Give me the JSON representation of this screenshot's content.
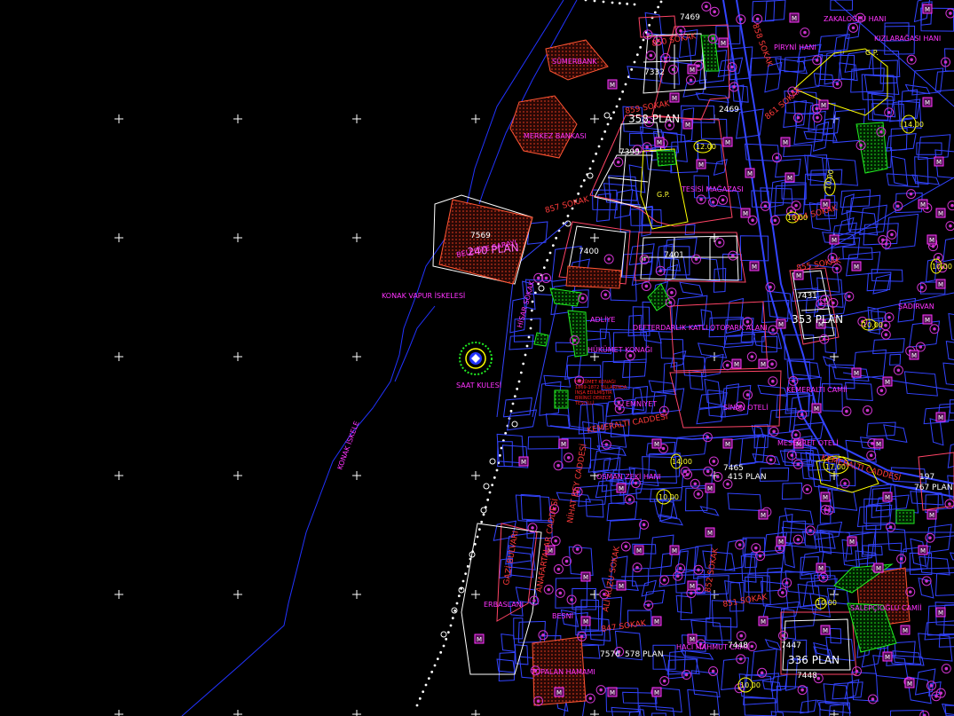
{
  "map": {
    "colors": {
      "background": "#000000",
      "coastline": "#2233ff",
      "parcel": "#3344ff",
      "parcel_pink": "#ff4466",
      "building_mag": "#ff33ff",
      "street_text": "#ff3a3a",
      "tree": "#cc33cc",
      "green": "#22ee22",
      "yellow": "#ffff00",
      "dots": "#ffffff",
      "hatch": "#aa2211",
      "grid_cross": "#ffffff"
    },
    "streets": {
      "s850": "850 SOKAK",
      "s859": "859 SOKAK",
      "s857": "857 SOKAK",
      "s861": "861 SOKAK",
      "s854": "854 SOKAK",
      "s855": "855 SOKAK",
      "s858": "858 SOKAK",
      "s851": "851 SOKAK",
      "s847": "847 SOKAK",
      "kemeralti": "KEMERALTI CADDESİ",
      "kemeralti_right": "KEMERALTI CADDESİ",
      "anafartalar": "ANAFARTALAR CADDESİ",
      "nihat": "NİHAT BEY CADDESİ",
      "cumhuriyet": "GAZİ BULVARI",
      "ali_ruza": "ALİ KUZU SOKAK",
      "konak_iskele": "KONAK İSKELE",
      "caddesi_852": "852 SOKAK",
      "cami_sok": "HİSAR SOKAK"
    },
    "places": {
      "pakaloglu": "ZAKALOĞLU HANI",
      "kiz_hani": "KIZLARAĞASI HANI",
      "pinyol_hani": "PİRYNİ HANI",
      "tesisi_magazasi": "TESİSİ MAĞAZASI",
      "merkez_bankasi": "MERKEZ BANKASI",
      "bankasi_top": "SÜMERBANK",
      "belediye": "BELEDİYE SARAYI",
      "konak_vapur": "KONAK VAPUR İSKELESİ",
      "saat_kulesi": "SAAT KULESİ",
      "adliye": "ADLİYE",
      "hukumet": "HÜKÜMET KONAĞI",
      "defterdarlik": "DEFTERDARLIK KATLI OTOPARK ALANI",
      "emniyet": "EMNİYET",
      "sinan_oteli": "SİNAN OTELİ",
      "kemeralti_cami": "KEMERALTI CAMİİ",
      "mesrret": "MESERRET OTELİ",
      "sadirvan": "ŞADIRVAN",
      "kizlar_yeni": "OSMAN ZEKİ HANI",
      "hacimahmut": "HACI MAHMUT CAMİİ",
      "tepecioglu": "SALEPÇİOĞLU CAMİİ",
      "erbasi_hani": "ERBASLANI",
      "birsel": "BESNİ",
      "camlica": "TOPALAN HAMAMI",
      "gp1": "G.P.",
      "gp2": "G.P.",
      "hukumet_note1": "HÜKÜMET KONAĞI",
      "hukumet_note2": "1869-1872 YILLARINDA",
      "hukumet_note3": "İNŞA EDİLMİŞTİR",
      "hukumet_note4": "BİRİNCİ DERECE",
      "hukumet_note5": "TESCİLLİ"
    },
    "numbers": {
      "n7469": "7469",
      "n7332": "7332",
      "n7399": "7399",
      "n2469": "2469",
      "n7400": "7400",
      "n7401": "7401",
      "n7431": "7431",
      "n7465": "7465",
      "n7447": "7447",
      "n7448": "7448",
      "n7576": "7576",
      "n7448b": "7448",
      "n197": "197",
      "n7569": "7569"
    },
    "plans": {
      "p358": "358 PLAN",
      "p240": "240 PLAN",
      "p353": "353 PLAN",
      "p415": "415 PLAN",
      "p336": "336 PLAN",
      "p578": "578 PLAN",
      "p767": "767 PLAN"
    },
    "elevations": {
      "e1": "12.00",
      "e2": "14.00",
      "e3": "10.00",
      "e4": "10.00",
      "e5": "17.00",
      "e6": "10.00",
      "e7": "10.00",
      "e8": "14.00",
      "e9": "10.00",
      "e10": "10.00",
      "e11": "10.00"
    },
    "marker_letter": "M"
  }
}
